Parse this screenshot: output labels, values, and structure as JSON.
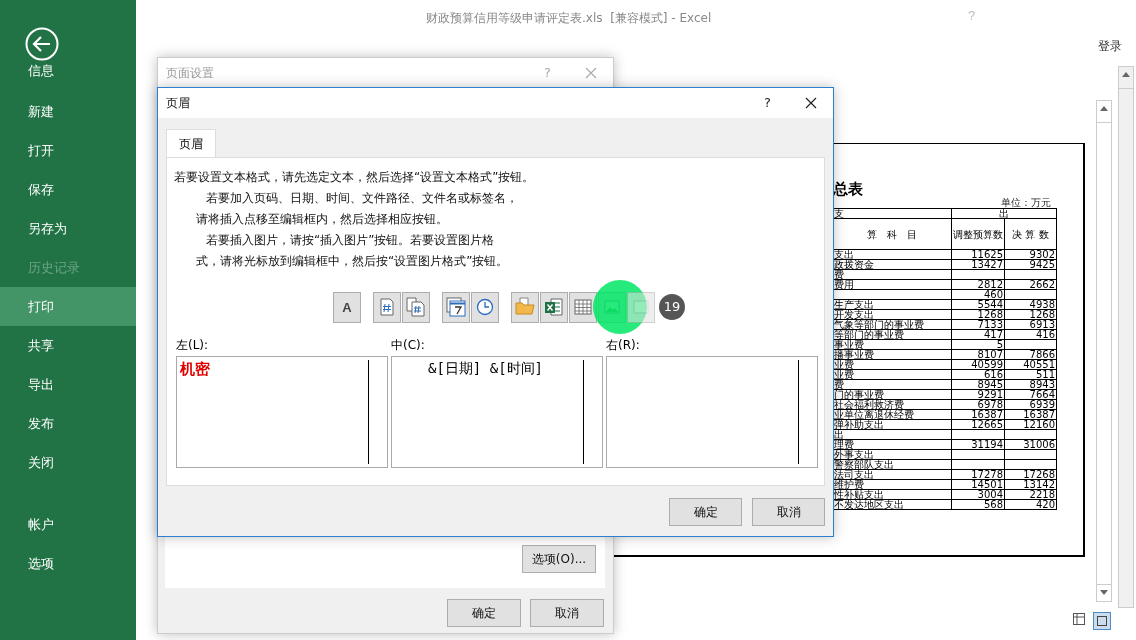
{
  "window": {
    "title": "财政预算信用等级申请评定表.xls  [兼容模式] - Excel",
    "help": "?",
    "sign_in": "登录"
  },
  "backstage": {
    "back_label": "信息",
    "items": [
      {
        "label": "新建",
        "selected": false,
        "disabled": false
      },
      {
        "label": "打开",
        "selected": false,
        "disabled": false
      },
      {
        "label": "保存",
        "selected": false,
        "disabled": false
      },
      {
        "label": "另存为",
        "selected": false,
        "disabled": false
      },
      {
        "label": "历史记录",
        "selected": false,
        "disabled": true
      },
      {
        "label": "打印",
        "selected": true,
        "disabled": false
      },
      {
        "label": "共享",
        "selected": false,
        "disabled": false
      },
      {
        "label": "导出",
        "selected": false,
        "disabled": false
      },
      {
        "label": "发布",
        "selected": false,
        "disabled": false
      },
      {
        "label": "关闭",
        "selected": false,
        "disabled": false
      }
    ],
    "footer_items": [
      {
        "label": "帐户",
        "selected": false,
        "disabled": false
      },
      {
        "label": "选项",
        "selected": false,
        "disabled": false
      }
    ]
  },
  "page_setup_dialog": {
    "title": "页面设置",
    "help": "?",
    "options_button": "选项(O)...",
    "buttons": [
      "确定",
      "取消"
    ]
  },
  "header_dialog": {
    "title": "页眉",
    "help": "?",
    "tabs": [
      {
        "label": "页眉",
        "selected": true
      }
    ],
    "instructions": [
      {
        "text": "若要设置文本格式，请先选定文本，然后选择“设置文本格式”按钮。",
        "kind": "lead"
      },
      {
        "text": "若要加入页码、日期、时间、文件路径、文件名或标签名，",
        "kind": "paragraph"
      },
      {
        "text": "请将插入点移至编辑框内，然后选择相应按钮。",
        "kind": "continued"
      },
      {
        "text": "若要插入图片，请按“插入图片”按钮。若要设置图片格",
        "kind": "paragraph"
      },
      {
        "text": "式，请将光标放到编辑框中，然后按“设置图片格式”按钮。",
        "kind": "continued"
      }
    ],
    "toolbar": [
      {
        "kind": "format-text",
        "label": "A",
        "disabled": false,
        "highlighted": false
      },
      {
        "kind": "page-number",
        "disabled": false,
        "highlighted": false
      },
      {
        "kind": "page-count",
        "disabled": false,
        "highlighted": false
      },
      {
        "kind": "date",
        "disabled": false,
        "highlighted": false
      },
      {
        "kind": "time",
        "disabled": false,
        "highlighted": false
      },
      {
        "kind": "file-path",
        "disabled": false,
        "highlighted": false
      },
      {
        "kind": "file-name",
        "disabled": false,
        "highlighted": false
      },
      {
        "kind": "sheet-name",
        "disabled": false,
        "highlighted": false
      },
      {
        "kind": "insert-picture",
        "disabled": false,
        "highlighted": true
      },
      {
        "kind": "format-picture",
        "disabled": true,
        "highlighted": false
      }
    ],
    "step_badge": "19",
    "sections": [
      {
        "label": "左(L):",
        "content": "机密",
        "color": "#e00000"
      },
      {
        "label": "中(C):",
        "content": "&[日期] &[时间]",
        "color": "#000000"
      },
      {
        "label": "右(R):"
      }
    ],
    "buttons": [
      "确定",
      "取消"
    ]
  },
  "print_preview": {
    "title": "总表",
    "unit": "单位：万元",
    "header_top": [
      "支",
      "出"
    ],
    "columns": [
      "算　科　目",
      "调整预算数",
      "决 算 数"
    ],
    "rows": [
      [
        "支出",
        "11625",
        "9302"
      ],
      [
        "政拨资金",
        "13427",
        "9425"
      ],
      [
        "费",
        "",
        ""
      ],
      [
        "费用",
        "2812",
        "2662"
      ],
      [
        "",
        "460",
        ""
      ],
      [
        "生产支出",
        "5544",
        "4938"
      ],
      [
        "开发支出",
        "1268",
        "1268"
      ],
      [
        "气象等部门的事业费",
        "7133",
        "6913"
      ],
      [
        "等部门的事业费",
        "417",
        "416"
      ],
      [
        "事业费",
        "5",
        ""
      ],
      [
        "播事业费",
        "8107",
        "7866"
      ],
      [
        "业费",
        "40599",
        "40551"
      ],
      [
        "业费",
        "616",
        "511"
      ],
      [
        "费",
        "8945",
        "8943"
      ],
      [
        "门的事业费",
        "9291",
        "7664"
      ],
      [
        "社会福利救济费",
        "6978",
        "6939"
      ],
      [
        "业单位离退休经费",
        "16387",
        "16387"
      ],
      [
        "弹补助支出",
        "12665",
        "12160"
      ],
      [
        "出",
        "",
        ""
      ],
      [
        "理费",
        "31194",
        "31006"
      ],
      [
        "外事支出",
        "",
        ""
      ],
      [
        "警察部队支出",
        "",
        ""
      ],
      [
        "法司支出",
        "17278",
        "17268"
      ],
      [
        "维护费",
        "14501",
        "13142"
      ],
      [
        "性补贴支出",
        "3004",
        "2218"
      ],
      [
        "不发达地区支出",
        "568",
        "420"
      ]
    ]
  }
}
